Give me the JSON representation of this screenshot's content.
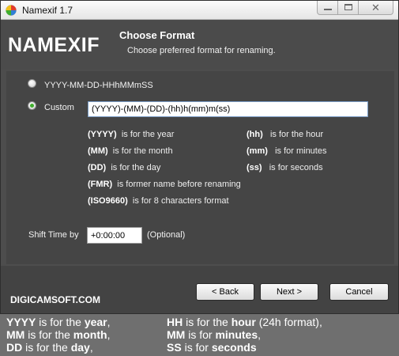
{
  "window": {
    "title": "Namexif 1.7",
    "close_glyph": "✕"
  },
  "header": {
    "logo": "NAMEXIF",
    "title": "Choose Format",
    "subtitle": "Choose preferred format for renaming."
  },
  "options": {
    "preset_label": "YYYY-MM-DD-HHhMMmSS",
    "preset_selected": false,
    "custom_label": "Custom",
    "custom_selected": true,
    "custom_value": "(YYYY)-(MM)-(DD)-(hh)h(mm)m(ss)"
  },
  "legend": {
    "left": [
      {
        "code": "(YYYY)",
        "text": "is for the year"
      },
      {
        "code": "(MM)",
        "text": "is for the month"
      },
      {
        "code": "(DD)",
        "text": "is for the day"
      },
      {
        "code": "(FMR)",
        "text": "is former name before renaming"
      },
      {
        "code": "(ISO9660)",
        "text": "is for 8 characters format"
      }
    ],
    "right": [
      {
        "code": "(hh)",
        "text": "is for the hour"
      },
      {
        "code": "(mm)",
        "text": "is for minutes"
      },
      {
        "code": "(ss)",
        "text": "is for seconds"
      }
    ]
  },
  "shift": {
    "label": "Shift Time by",
    "value": "+0:00:00",
    "optional": "(Optional)"
  },
  "footer": {
    "logo": "DIGICAMSOFT.COM",
    "back": "< Back",
    "next": "Next >",
    "cancel": "Cancel"
  },
  "caption": {
    "line1_left": {
      "pre": "YYYY",
      "mid": " is for the ",
      "bold": "year",
      "post": ","
    },
    "line1_right": {
      "pre": "HH",
      "mid": " is for the ",
      "bold": "hour",
      "post": " (24h format),"
    },
    "line2_left": {
      "pre": "MM",
      "mid": " is for the ",
      "bold": "month",
      "post": ","
    },
    "line2_right": {
      "pre": "MM",
      "mid": " is for ",
      "bold": "minutes",
      "post": ","
    },
    "line3_left": {
      "pre": "DD",
      "mid": " is for the ",
      "bold": "day",
      "post": ","
    },
    "line3_right": {
      "pre": "SS",
      "mid": " is for ",
      "bold": "seconds",
      "post": ""
    }
  },
  "colors": {
    "radio_selected": "#3fae2d",
    "background": "#4d4d4d"
  },
  "icons": {
    "app": "camera-pinwheel-icon",
    "minimize": "minimize-icon",
    "maximize": "maximize-icon",
    "close": "close-icon"
  }
}
